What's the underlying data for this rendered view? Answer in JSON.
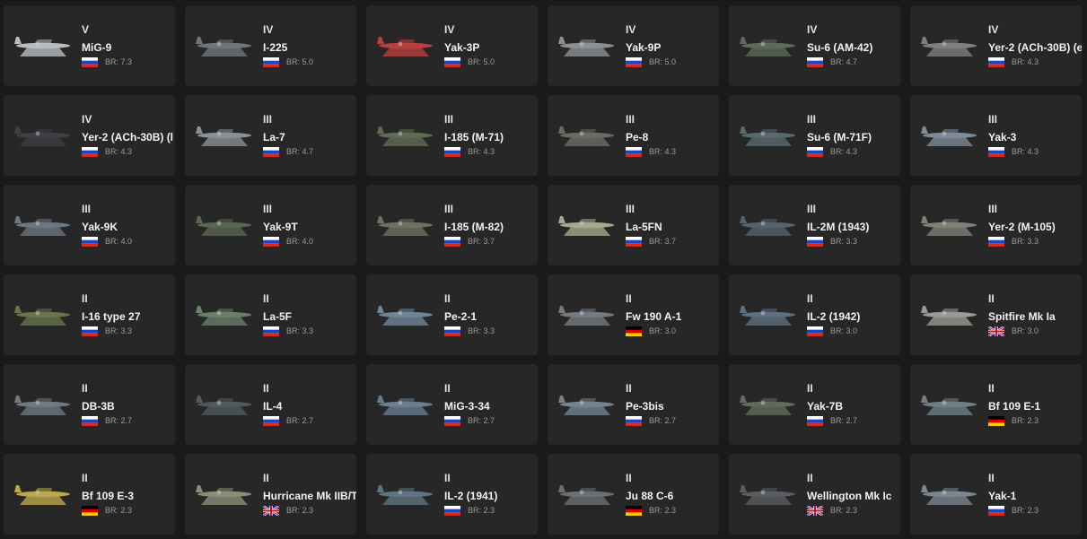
{
  "vehicles": [
    {
      "rank": "V",
      "name": "MiG-9",
      "br": "BR: 7.3",
      "nation": "ussr",
      "color": "#b9bcbf",
      "icon": "jet-plane-icon"
    },
    {
      "rank": "IV",
      "name": "I-225",
      "br": "BR: 5.0",
      "nation": "ussr",
      "color": "#6f757a",
      "icon": "fighter-plane-icon"
    },
    {
      "rank": "IV",
      "name": "Yak-3P",
      "br": "BR: 5.0",
      "nation": "ussr",
      "color": "#b9403f",
      "icon": "fighter-plane-icon"
    },
    {
      "rank": "IV",
      "name": "Yak-9P",
      "br": "BR: 5.0",
      "nation": "ussr",
      "color": "#8c9092",
      "icon": "fighter-plane-icon"
    },
    {
      "rank": "IV",
      "name": "Su-6 (AM-42)",
      "br": "BR: 4.7",
      "nation": "ussr",
      "color": "#5d6a58",
      "icon": "attacker-plane-icon"
    },
    {
      "rank": "IV",
      "name": "Yer-2 (ACh-30B) (e",
      "br": "BR: 4.3",
      "nation": "ussr",
      "color": "#7f7f7f",
      "icon": "bomber-plane-icon"
    },
    {
      "rank": "IV",
      "name": "Yer-2 (ACh-30B) (l",
      "br": "BR: 4.3",
      "nation": "ussr",
      "color": "#3c3f44",
      "icon": "bomber-plane-icon"
    },
    {
      "rank": "III",
      "name": "La-7",
      "br": "BR: 4.7",
      "nation": "ussr",
      "color": "#8b9095",
      "icon": "fighter-plane-icon"
    },
    {
      "rank": "III",
      "name": "I-185 (M-71)",
      "br": "BR: 4.3",
      "nation": "ussr",
      "color": "#5f6b55",
      "icon": "fighter-plane-icon"
    },
    {
      "rank": "III",
      "name": "Pe-8",
      "br": "BR: 4.3",
      "nation": "ussr",
      "color": "#6b6b66",
      "icon": "bomber-plane-icon"
    },
    {
      "rank": "III",
      "name": "Su-6 (M-71F)",
      "br": "BR: 4.3",
      "nation": "ussr",
      "color": "#5a6870",
      "icon": "attacker-plane-icon"
    },
    {
      "rank": "III",
      "name": "Yak-3",
      "br": "BR: 4.3",
      "nation": "ussr",
      "color": "#7d8a97",
      "icon": "fighter-plane-icon"
    },
    {
      "rank": "III",
      "name": "Yak-9K",
      "br": "BR: 4.0",
      "nation": "ussr",
      "color": "#6c7782",
      "icon": "fighter-plane-icon"
    },
    {
      "rank": "III",
      "name": "Yak-9T",
      "br": "BR: 4.0",
      "nation": "ussr",
      "color": "#5b6650",
      "icon": "fighter-plane-icon"
    },
    {
      "rank": "III",
      "name": "I-185 (M-82)",
      "br": "BR: 3.7",
      "nation": "ussr",
      "color": "#6b7360",
      "icon": "fighter-plane-icon"
    },
    {
      "rank": "III",
      "name": "La-5FN",
      "br": "BR: 3.7",
      "nation": "ussr",
      "color": "#a8a890",
      "icon": "fighter-plane-icon"
    },
    {
      "rank": "III",
      "name": "IL-2M (1943)",
      "br": "BR: 3.3",
      "nation": "ussr",
      "color": "#55636b",
      "icon": "attacker-plane-icon"
    },
    {
      "rank": "III",
      "name": "Yer-2 (M-105)",
      "br": "BR: 3.3",
      "nation": "ussr",
      "color": "#7c8278",
      "icon": "bomber-plane-icon"
    },
    {
      "rank": "II",
      "name": "I-16 type 27",
      "br": "BR: 3.3",
      "nation": "ussr",
      "color": "#69734e",
      "icon": "fighter-plane-icon"
    },
    {
      "rank": "II",
      "name": "La-5F",
      "br": "BR: 3.3",
      "nation": "ussr",
      "color": "#6a7e6a",
      "icon": "fighter-plane-icon"
    },
    {
      "rank": "II",
      "name": "Pe-2-1",
      "br": "BR: 3.3",
      "nation": "ussr",
      "color": "#6f8398",
      "icon": "bomber-plane-icon"
    },
    {
      "rank": "II",
      "name": "Fw 190 A-1",
      "br": "BR: 3.0",
      "nation": "germany",
      "color": "#737a80",
      "icon": "fighter-plane-icon"
    },
    {
      "rank": "II",
      "name": "IL-2 (1942)",
      "br": "BR: 3.0",
      "nation": "ussr",
      "color": "#5d7080",
      "icon": "attacker-plane-icon"
    },
    {
      "rank": "II",
      "name": "Spitfire Mk Ia",
      "br": "BR: 3.0",
      "nation": "uk",
      "color": "#9a9a94",
      "icon": "fighter-plane-icon"
    },
    {
      "rank": "II",
      "name": "DB-3B",
      "br": "BR: 2.7",
      "nation": "ussr",
      "color": "#6e7a80",
      "icon": "bomber-plane-icon"
    },
    {
      "rank": "II",
      "name": "IL-4",
      "br": "BR: 2.7",
      "nation": "ussr",
      "color": "#505a5e",
      "icon": "bomber-plane-icon"
    },
    {
      "rank": "II",
      "name": "MiG-3-34",
      "br": "BR: 2.7",
      "nation": "ussr",
      "color": "#6a7d8c",
      "icon": "fighter-plane-icon"
    },
    {
      "rank": "II",
      "name": "Pe-3bis",
      "br": "BR: 2.7",
      "nation": "ussr",
      "color": "#73838f",
      "icon": "fighter-plane-icon"
    },
    {
      "rank": "II",
      "name": "Yak-7B",
      "br": "BR: 2.7",
      "nation": "ussr",
      "color": "#606c58",
      "icon": "fighter-plane-icon"
    },
    {
      "rank": "II",
      "name": "Bf 109 E-1",
      "br": "BR: 2.3",
      "nation": "germany",
      "color": "#6f7f84",
      "icon": "fighter-plane-icon"
    },
    {
      "rank": "II",
      "name": "Bf 109 E-3",
      "br": "BR: 2.3",
      "nation": "germany",
      "color": "#b9a84c",
      "icon": "fighter-plane-icon"
    },
    {
      "rank": "II",
      "name": "Hurricane Mk IIB/T",
      "br": "BR: 2.3",
      "nation": "uk",
      "color": "#8a8d78",
      "icon": "fighter-plane-icon"
    },
    {
      "rank": "II",
      "name": "IL-2 (1941)",
      "br": "BR: 2.3",
      "nation": "ussr",
      "color": "#5f7480",
      "icon": "attacker-plane-icon"
    },
    {
      "rank": "II",
      "name": "Ju 88 C-6",
      "br": "BR: 2.3",
      "nation": "germany",
      "color": "#6b6f72",
      "icon": "bomber-plane-icon"
    },
    {
      "rank": "II",
      "name": "Wellington Mk Ic",
      "br": "BR: 2.3",
      "nation": "uk",
      "color": "#5a5c60",
      "icon": "bomber-plane-icon"
    },
    {
      "rank": "II",
      "name": "Yak-1",
      "br": "BR: 2.3",
      "nation": "ussr",
      "color": "#7b8690",
      "icon": "fighter-plane-icon"
    }
  ]
}
